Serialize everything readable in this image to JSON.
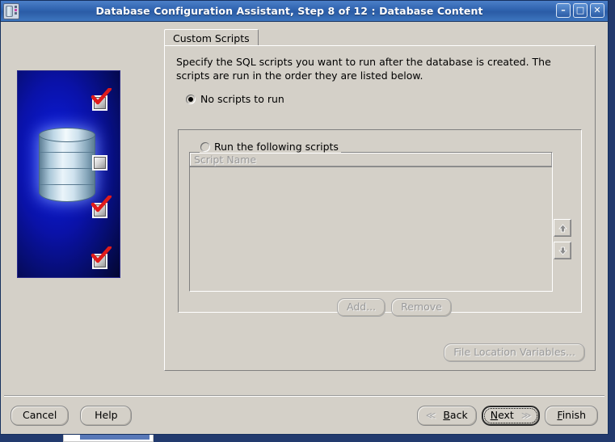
{
  "window": {
    "title": "Database Configuration Assistant, Step 8 of 12 : Database Content",
    "icon": "database-server-icon",
    "minimize_label": "–",
    "maximize_label": "□",
    "close_label": "✕"
  },
  "sidebar": {
    "image_alt": "database-cylinder-graphic",
    "steps": [
      {
        "state": "checked"
      },
      {
        "state": "unchecked"
      },
      {
        "state": "checked"
      },
      {
        "state": "checked"
      },
      {
        "state": "unchecked"
      }
    ]
  },
  "main": {
    "tabs": [
      {
        "label": "Custom Scripts",
        "selected": true
      }
    ],
    "description": "Specify the SQL scripts you want to run after the database is created. The scripts are run in the order they are listed below.",
    "options": [
      {
        "label": "No scripts to run",
        "selected": true
      },
      {
        "label": "Run the following scripts",
        "selected": false
      }
    ],
    "table": {
      "columns": [
        "Script Name"
      ],
      "rows": []
    },
    "order_buttons": [
      {
        "name": "move-up",
        "glyph": "▲"
      },
      {
        "name": "move-down",
        "glyph": "▼"
      }
    ],
    "list_buttons": [
      {
        "label": "Add...",
        "enabled": false
      },
      {
        "label": "Remove",
        "enabled": false
      }
    ],
    "file_location_button": {
      "label": "File Location Variables...",
      "enabled": false
    }
  },
  "footer": {
    "cancel": "Cancel",
    "help": "Help",
    "back": "Back",
    "back_mnemonic": "B",
    "next": "Next",
    "next_mnemonic": "N",
    "finish": "Finish",
    "finish_mnemonic": "F",
    "back_arrow": "≪",
    "next_arrow": "≫"
  },
  "colors": {
    "title_bar": "#2f62ae",
    "window_bg": "#d4d0c8",
    "banner_blue": "#0a12a8",
    "check_red": "#e01b1b",
    "disabled_text": "#9a9a9a",
    "desktop": "#223a6e"
  }
}
